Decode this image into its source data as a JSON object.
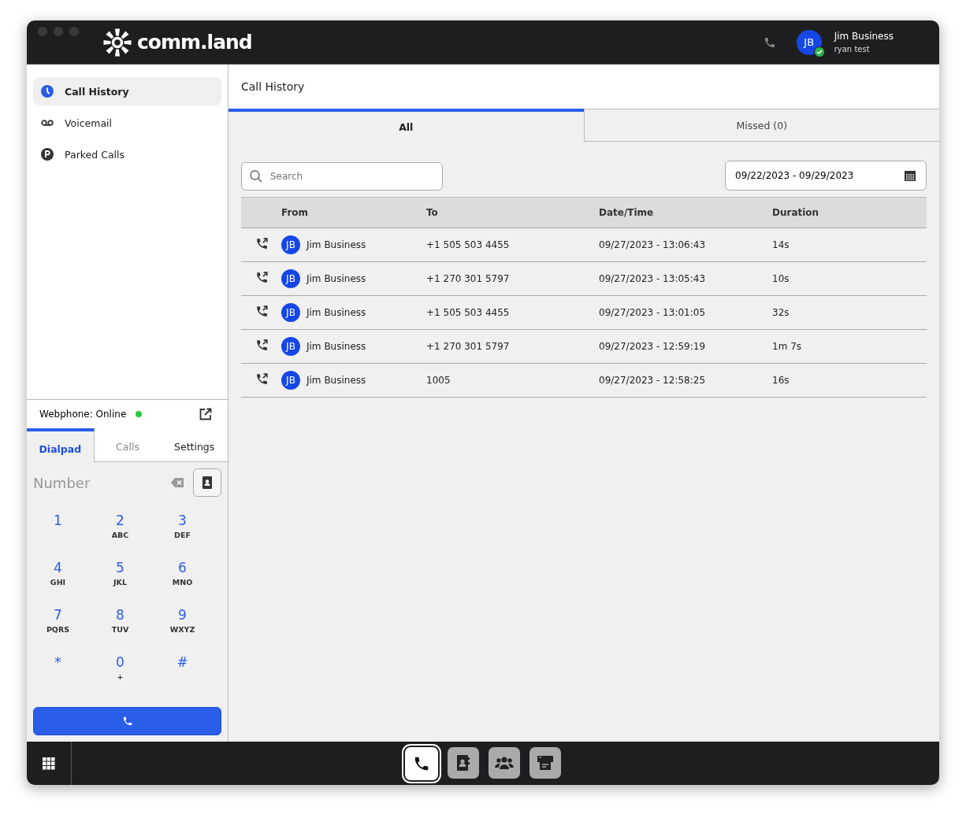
{
  "titlebar": {
    "logo_text": "comm.land",
    "user": {
      "initials": "JB",
      "name": "Jim Business",
      "subtitle": "ryan test",
      "online": true
    }
  },
  "sidebar": {
    "items": [
      {
        "kind": "clock",
        "label": "Call History",
        "selected": true
      },
      {
        "kind": "voicemail",
        "label": "Voicemail",
        "selected": false
      },
      {
        "kind": "parked",
        "label": "Parked Calls",
        "selected": false
      }
    ]
  },
  "webphone": {
    "status": "Webphone: Online",
    "online": true,
    "tabs": [
      {
        "label": "Dialpad",
        "selected": true,
        "disabled": false
      },
      {
        "label": "Calls",
        "selected": false,
        "disabled": true
      },
      {
        "label": "Settings",
        "selected": false,
        "disabled": false
      }
    ],
    "number": {
      "placeholder": "Number"
    },
    "keys": [
      {
        "digit": "1"
      },
      {
        "digit": "2",
        "letters": "ABC"
      },
      {
        "digit": "3",
        "letters": "DEF"
      },
      {
        "digit": "4",
        "letters": "GHI"
      },
      {
        "digit": "5",
        "letters": "JKL"
      },
      {
        "digit": "6",
        "letters": "MNO"
      },
      {
        "digit": "7",
        "letters": "PQRS"
      },
      {
        "digit": "8",
        "letters": "TUV"
      },
      {
        "digit": "9",
        "letters": "WXYZ"
      },
      {
        "digit": "*"
      },
      {
        "digit": "0",
        "letters": "+"
      },
      {
        "digit": "#"
      }
    ]
  },
  "main": {
    "title": "Call History",
    "tabs": [
      {
        "label": "All",
        "selected": true
      },
      {
        "label": "Missed (0)",
        "selected": false
      }
    ],
    "search": {
      "placeholder": "Search"
    },
    "date_range": "09/22/2023 - 09/29/2023",
    "table": {
      "columns": [
        "From",
        "To",
        "Date/Time",
        "Duration"
      ],
      "rows": [
        {
          "initials": "JB",
          "from": "Jim Business",
          "to": "+1 505 503 4455",
          "datetime": "09/27/2023 - 13:06:43",
          "duration": "14s"
        },
        {
          "initials": "JB",
          "from": "Jim Business",
          "to": "+1 270 301 5797",
          "datetime": "09/27/2023 - 13:05:43",
          "duration": "10s"
        },
        {
          "initials": "JB",
          "from": "Jim Business",
          "to": "+1 505 503 4455",
          "datetime": "09/27/2023 - 13:01:05",
          "duration": "32s"
        },
        {
          "initials": "JB",
          "from": "Jim Business",
          "to": "+1 270 301 5797",
          "datetime": "09/27/2023 - 12:59:19",
          "duration": "1m 7s"
        },
        {
          "initials": "JB",
          "from": "Jim Business",
          "to": "1005",
          "datetime": "09/27/2023 - 12:58:25",
          "duration": "16s"
        }
      ]
    }
  },
  "dock": {
    "items": [
      {
        "kind": "phone",
        "selected": true
      },
      {
        "kind": "contacts",
        "selected": false
      },
      {
        "kind": "group",
        "selected": false
      },
      {
        "kind": "fax",
        "selected": false
      }
    ]
  }
}
